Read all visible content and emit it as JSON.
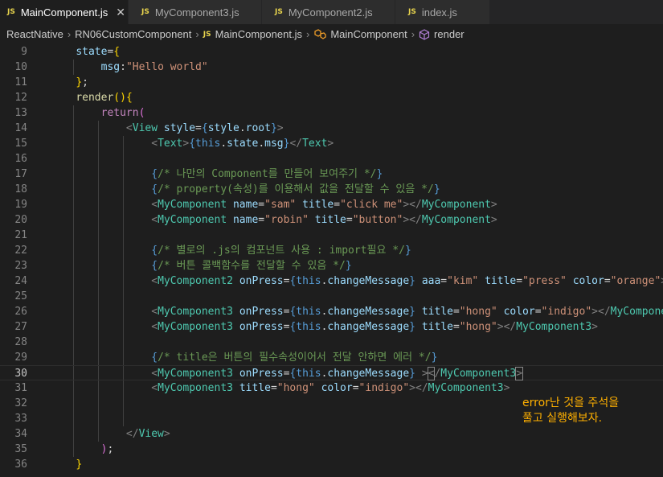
{
  "tabs": [
    {
      "label": "MainComponent.js",
      "active": true
    },
    {
      "label": "MyComponent3.js"
    },
    {
      "label": "MyComponent2.js"
    },
    {
      "label": "index.js"
    }
  ],
  "tab_icon_text": "JS",
  "close_glyph": "✕",
  "breadcrumb": [
    "ReactNative",
    "RN06CustomComponent",
    "MainComponent.js",
    "MainComponent",
    "render"
  ],
  "line_numbers": [
    "9",
    "10",
    "11",
    "12",
    "13",
    "14",
    "15",
    "16",
    "17",
    "18",
    "19",
    "20",
    "21",
    "22",
    "23",
    "24",
    "25",
    "26",
    "27",
    "28",
    "29",
    "30",
    "31",
    "32",
    "33",
    "34",
    "35",
    "36"
  ],
  "annotation": {
    "line1": "error난 것을 주석을",
    "line2": "풀고 실행해보자."
  },
  "colors": {
    "accent_js": "#e8d44d",
    "annotation": "#ffb000",
    "background": "#1e1e1e"
  }
}
